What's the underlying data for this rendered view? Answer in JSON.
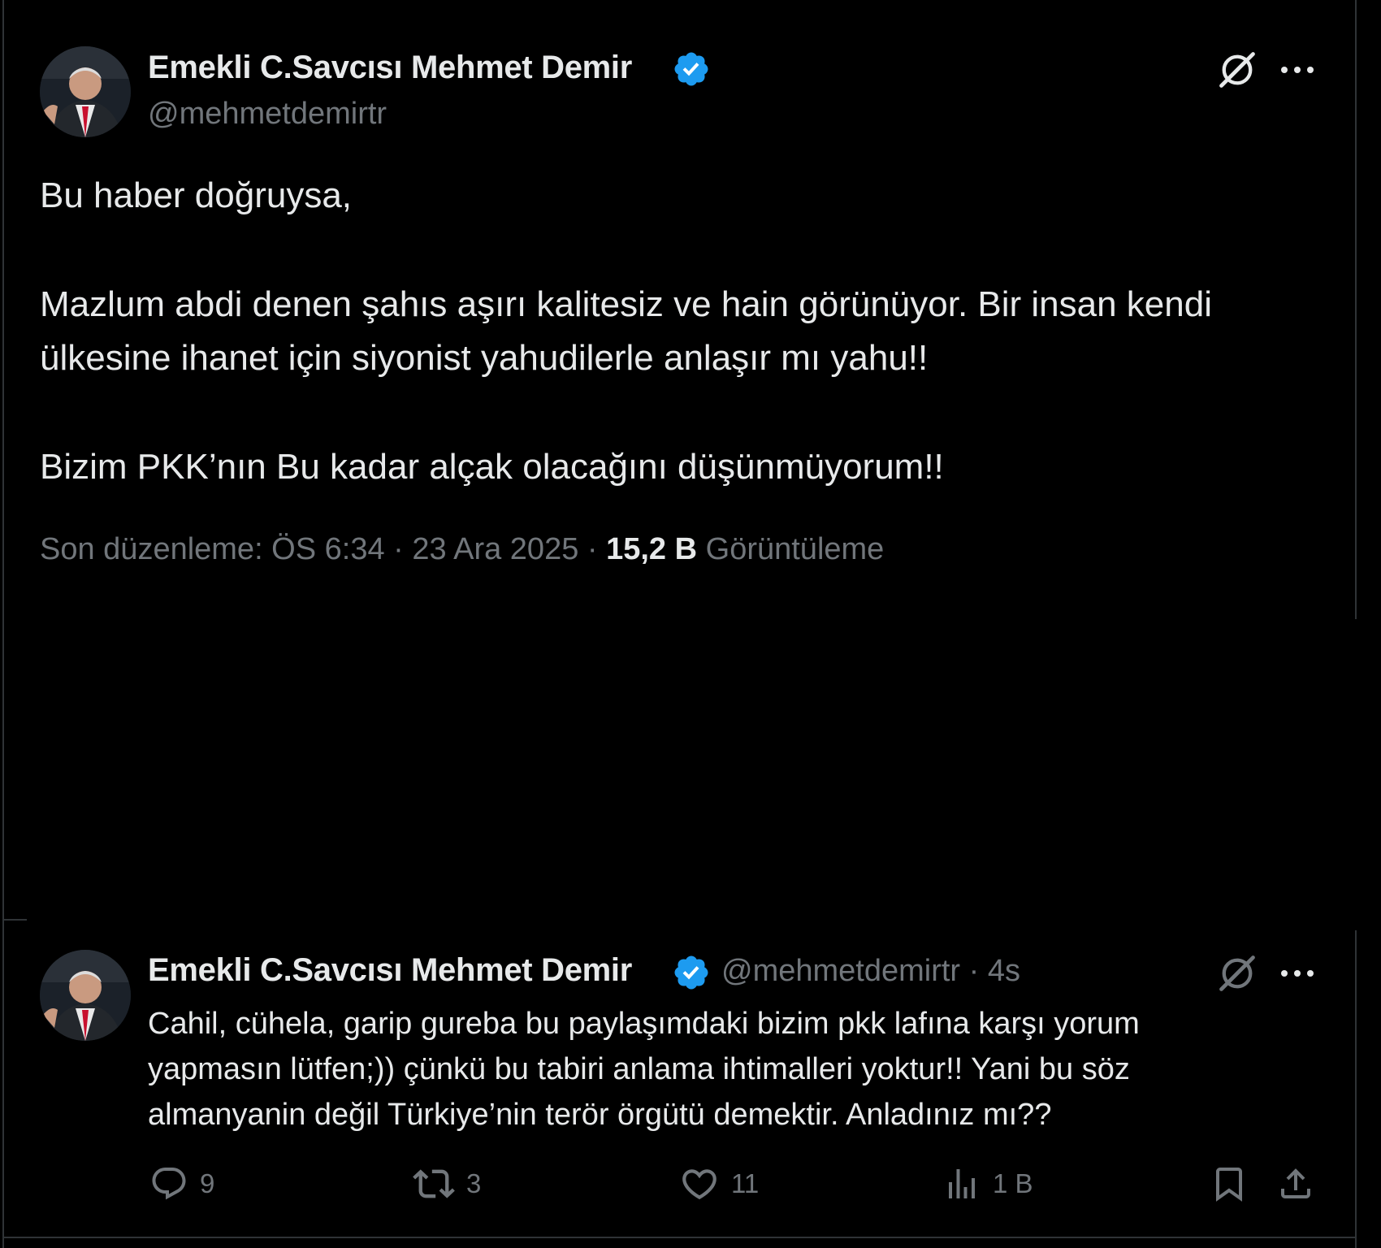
{
  "tweet": {
    "author": {
      "display_name": "Emekli C.Savcısı Mehmet Demir",
      "handle": "@mehmetdemirtr",
      "verified": true,
      "verified_color": "#1d9bf0"
    },
    "text_lines": [
      "Bu haber doğruysa,",
      "Mazlum abdi denen şahıs aşırı kalitesiz ve hain görünüyor. Bir insan kendi",
      "ülkesine ihanet için siyonist yahudilerle anlaşır mı yahu!!",
      "Bizim PKK’nın Bu kadar alçak olacağını düşünmüyorum!!"
    ],
    "meta": {
      "edited_prefix": "Son düzenleme: ÖS 6:34 · 23 Ara 2025 · ",
      "views_count": "15,2 B",
      "views_label": " Görüntüleme"
    },
    "icons": [
      "grok-icon",
      "more-icon"
    ]
  },
  "reply": {
    "author": {
      "display_name": "Emekli C.Savcısı Mehmet Demir",
      "handle_time": "@mehmetdemirtr · 4s",
      "verified": true
    },
    "text_lines": [
      "Cahil, cühela, garip gureba bu paylaşımdaki bizim pkk lafına karşı yorum",
      "yapmasın lütfen;)) çünkü bu tabiri anlama ihtimalleri yoktur!! Yani bu söz",
      "almanyanin değil Türkiye’nin terör örgütü demektir. Anladınız mı??"
    ],
    "actions": {
      "replies": "9",
      "reposts": "3",
      "likes": "11",
      "views": "1 B"
    },
    "icons": [
      "reply-icon",
      "repost-icon",
      "like-icon",
      "views-icon",
      "bookmark-icon",
      "share-icon"
    ]
  },
  "colors": {
    "background": "#000000",
    "text_primary": "#e7e9ea",
    "text_secondary": "#71767b",
    "border": "#2f3336",
    "accent": "#1d9bf0"
  }
}
